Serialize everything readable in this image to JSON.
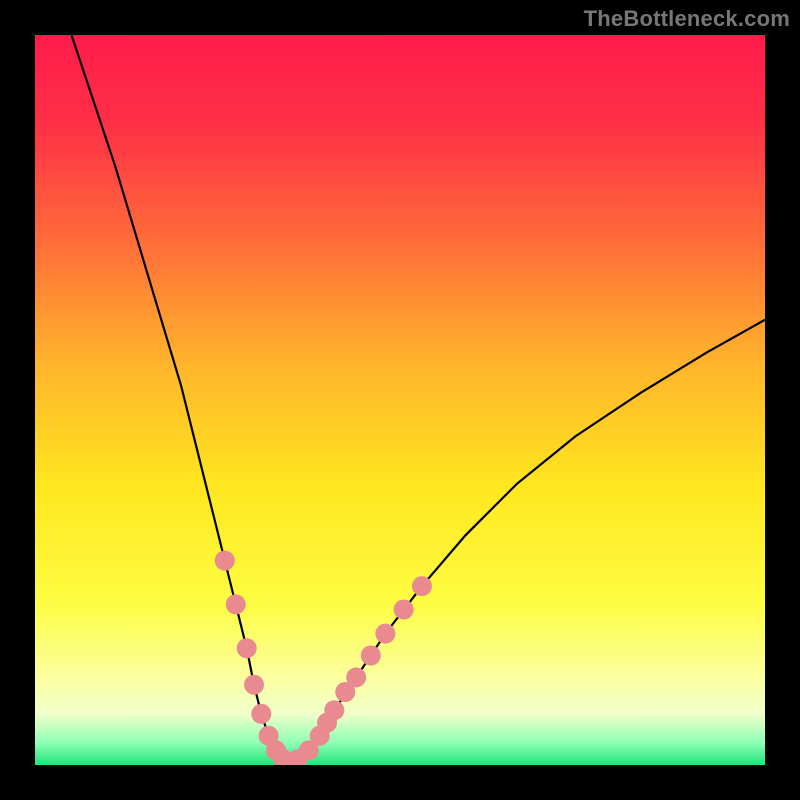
{
  "watermark": "TheBottleneck.com",
  "chart_data": {
    "type": "line",
    "title": "",
    "xlabel": "",
    "ylabel": "",
    "xlim": [
      0,
      100
    ],
    "ylim": [
      0,
      100
    ],
    "background": {
      "type": "vertical-gradient",
      "stops": [
        {
          "pos": 0.0,
          "color": "#ff1c4b"
        },
        {
          "pos": 0.12,
          "color": "#ff2f47"
        },
        {
          "pos": 0.28,
          "color": "#ff6b39"
        },
        {
          "pos": 0.45,
          "color": "#ffb42c"
        },
        {
          "pos": 0.62,
          "color": "#ffe71f"
        },
        {
          "pos": 0.78,
          "color": "#fdfd43"
        },
        {
          "pos": 0.88,
          "color": "#fcffa0"
        },
        {
          "pos": 0.93,
          "color": "#f1ffca"
        },
        {
          "pos": 0.97,
          "color": "#8cffb4"
        },
        {
          "pos": 1.0,
          "color": "#22e47a"
        }
      ]
    },
    "series": [
      {
        "name": "bottleneck-curve",
        "color": "#000000",
        "x": [
          5,
          8,
          11,
          14,
          17,
          20,
          22,
          24,
          26,
          27.5,
          29,
          30,
          31,
          32,
          33,
          34,
          35,
          36,
          37.5,
          39,
          41,
          44,
          48,
          53,
          59,
          66,
          74,
          83,
          92,
          100
        ],
        "y": [
          100,
          91,
          82,
          72,
          62,
          52,
          44,
          36,
          28,
          22,
          16,
          11,
          7,
          4,
          2,
          0.8,
          0.3,
          0.8,
          2,
          4,
          7.5,
          12,
          18,
          24.5,
          31.5,
          38.5,
          45,
          51,
          56.5,
          61
        ]
      }
    ],
    "scatter": [
      {
        "name": "highlight-dots",
        "color": "#e98990",
        "radius": 10,
        "points": [
          {
            "x": 26.0,
            "y": 28.0
          },
          {
            "x": 27.5,
            "y": 22.0
          },
          {
            "x": 29.0,
            "y": 16.0
          },
          {
            "x": 30.0,
            "y": 11.0
          },
          {
            "x": 31.0,
            "y": 7.0
          },
          {
            "x": 32.0,
            "y": 4.0
          },
          {
            "x": 33.0,
            "y": 2.0
          },
          {
            "x": 34.0,
            "y": 0.8
          },
          {
            "x": 35.0,
            "y": 0.3
          },
          {
            "x": 36.0,
            "y": 0.8
          },
          {
            "x": 37.5,
            "y": 2.0
          },
          {
            "x": 39.0,
            "y": 4.0
          },
          {
            "x": 40.0,
            "y": 5.8
          },
          {
            "x": 41.0,
            "y": 7.5
          },
          {
            "x": 42.5,
            "y": 10.0
          },
          {
            "x": 44.0,
            "y": 12.0
          },
          {
            "x": 46.0,
            "y": 15.0
          },
          {
            "x": 48.0,
            "y": 18.0
          },
          {
            "x": 50.5,
            "y": 21.3
          },
          {
            "x": 53.0,
            "y": 24.5
          }
        ]
      }
    ]
  }
}
